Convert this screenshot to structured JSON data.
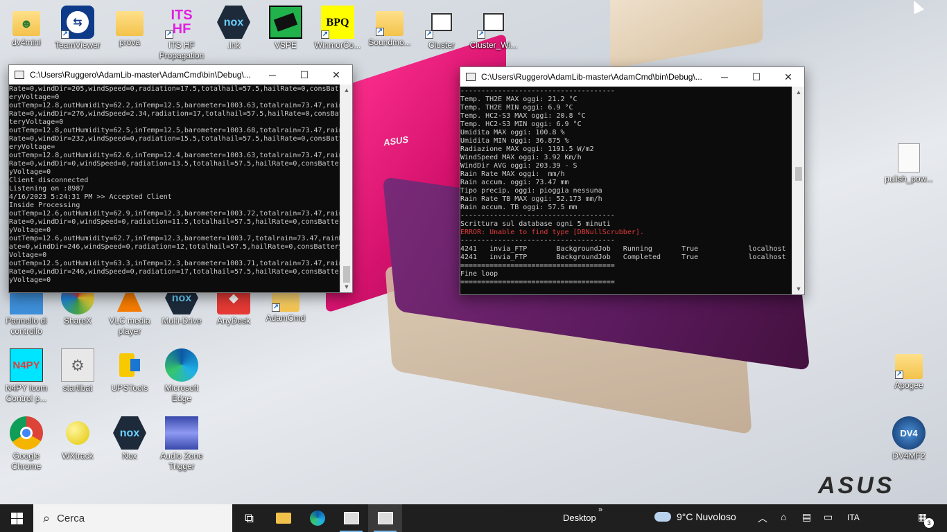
{
  "desktop": {
    "icons_left": [
      {
        "label": "dv4mini"
      },
      {
        "label": "TeamViewer"
      },
      {
        "label": "prova"
      },
      {
        "label": "ITS HF Propagation",
        "glyph": "ITS HF"
      },
      {
        "label": ".lnk",
        "glyph": "nox"
      },
      {
        "label": "VSPE"
      },
      {
        "label": "WinmorCo...",
        "glyph": "BPQ"
      },
      {
        "label": "Soundmo..."
      },
      {
        "label": "Cluster"
      },
      {
        "label": "Cluster_Wi..."
      }
    ],
    "row2": [
      {
        "label": "Pannello di controllo"
      },
      {
        "label": "ShareX"
      },
      {
        "label": "VLC media player"
      },
      {
        "label": "Multi-Drive",
        "glyph": "nox"
      },
      {
        "label": "AnyDesk"
      },
      {
        "label": "AdamCmd"
      }
    ],
    "row3": [
      {
        "label": "N4PY Icom Control p...",
        "glyph": "N4PY"
      },
      {
        "label": "startibat"
      },
      {
        "label": "UPSTools"
      },
      {
        "label": "Microsoft Edge"
      }
    ],
    "row4": [
      {
        "label": "Google Chrome"
      },
      {
        "label": "WXtrack"
      },
      {
        "label": "Nox",
        "glyph": "nox"
      },
      {
        "label": "Audio Zone Trigger"
      }
    ],
    "right_icons": [
      {
        "label": "pulish_pow..."
      },
      {
        "label": "Apogee"
      },
      {
        "label": "DV4MF2",
        "glyph": "DV4"
      }
    ],
    "wallpaper_brand": "ASUS"
  },
  "window_left": {
    "title": "C:\\Users\\Ruggero\\AdamLib-master\\AdamCmd\\bin\\Debug\\...",
    "lines": [
      "Rate=0,windDir=205,windSpeed=0,radiation=17.5,totalhail=57.5,hailRate=0,consBatt",
      "eryVoltage=0",
      "outTemp=12.8,outHumidity=62.2,inTemp=12.5,barometer=1003.63,totalrain=73.47,rain",
      "Rate=0,windDir=276,windSpeed=2.34,radiation=17,totalhail=57.5,hailRate=0,consBat",
      "teryVoltage=0",
      "outTemp=12.8,outHumidity=62.5,inTemp=12.5,barometer=1003.68,totalrain=73.47,rain",
      "Rate=0,windDir=232,windSpeed=0,radiation=15.5,totalhail=57.5,hailRate=0,consBatt",
      "eryVoltage=",
      "outTemp=12.8,outHumidity=62.6,inTemp=12.4,barometer=1003.63,totalrain=73.47,rain",
      "Rate=0,windDir=0,windSpeed=0,radiation=13.5,totalhail=57.5,hailRate=0,consBatter",
      "yVoltage=0",
      "Client disconnected",
      "Listening on :8987",
      "4/16/2023 5:24:31 PM >> Accepted Client",
      "Inside Processing",
      "outTemp=12.6,outHumidity=62.9,inTemp=12.3,barometer=1003.72,totalrain=73.47,rain",
      "Rate=0,windDir=0,windSpeed=0,radiation=11.5,totalhail=57.5,hailRate=0,consBatter",
      "yVoltage=0",
      "outTemp=12.6,outHumidity=62.7,inTemp=12.3,barometer=1003.7,totalrain=73.47,rainR",
      "ate=0,windDir=246,windSpeed=0,radiation=12,totalhail=57.5,hailRate=0,consBattery",
      "Voltage=0",
      "outTemp=12.5,outHumidity=63.3,inTemp=12.3,barometer=1003.71,totalrain=73.47,rain",
      "Rate=0,windDir=246,windSpeed=0,radiation=17,totalhail=57.5,hailRate=0,consBatter",
      "yVoltage=0"
    ]
  },
  "window_right": {
    "title": "C:\\Users\\Ruggero\\AdamLib-master\\AdamCmd\\bin\\Debug\\...",
    "lines": [
      "-------------------------------------",
      "Temp. TH2E MAX oggi: 21.2 °C",
      "Temp. TH2E MIN oggi: 6.9 °C",
      "Temp. HC2-S3 MAX oggi: 20.8 °C",
      "Temp. HC2-S3 MIN oggi: 6.9 °C",
      "Umidita MAX oggi: 100.8 %",
      "Umidita MIN oggi: 36.875 %",
      "Radiazione MAX oggi: 1191.5 W/m2",
      "WindSpeed MAX oggi: 3.92 Km/h",
      "WindDir AVG oggi: 203.39 - S",
      "Rain Rate MAX oggi:  mm/h",
      "Rain accum. oggi: 73.47 mm",
      "Tipo precip. oggi: pioggia nessuna",
      "Rain Rate TB MAX oggi: 52.173 mm/h",
      "Rain accum. TB oggi: 57.5 mm",
      "-------------------------------------",
      "Scrittura sul database ogni 5 minuti",
      "ERROR: Unable to find type [DBNullScrubber].",
      "-------------------------------------",
      "4241   invia_FTP       BackgroundJob   Running       True            localhost",
      "4241   invia_FTP       BackgroundJob   Completed     True            localhost",
      "=====================================",
      "Fine loop",
      "====================================="
    ],
    "error_line_index": 17
  },
  "taskbar": {
    "search_placeholder": "Cerca",
    "desktop_label": "Desktop",
    "weather": "9°C  Nuvoloso",
    "language": "ITA",
    "notification_count": "3"
  }
}
